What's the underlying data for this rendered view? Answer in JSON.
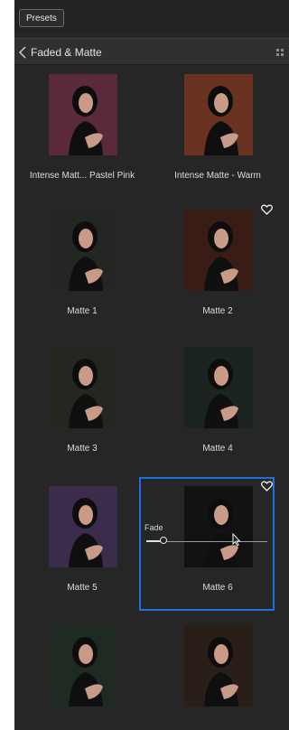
{
  "header": {
    "presets_button": "Presets"
  },
  "category": {
    "title": "Faded & Matte",
    "back_icon": "chevron-left-icon",
    "view_icon": "grid-icon"
  },
  "presets": [
    {
      "label": "Intense Matt... Pastel Pink",
      "tint": "#5a2a3c",
      "favorite": false
    },
    {
      "label": "Intense Matte - Warm",
      "tint": "#6a3220",
      "favorite": false
    },
    {
      "label": "Matte 1",
      "tint": "#232622",
      "favorite": false
    },
    {
      "label": "Matte 2",
      "tint": "#3a1c16",
      "favorite": true
    },
    {
      "label": "Matte 3",
      "tint": "#23271f",
      "favorite": false
    },
    {
      "label": "Matte 4",
      "tint": "#1c2420",
      "favorite": false
    },
    {
      "label": "Matte 5",
      "tint": "#3a2c4a",
      "favorite": false
    },
    {
      "label": "Matte 6",
      "tint": "#121212",
      "favorite": true
    },
    {
      "label": "",
      "tint": "#1e2a22",
      "favorite": false
    },
    {
      "label": "",
      "tint": "#2a1e18",
      "favorite": false
    }
  ],
  "fade_slider": {
    "label": "Fade",
    "value": 0.12
  },
  "colors": {
    "selection": "#1e6fd8",
    "panel_bg": "#262626"
  }
}
